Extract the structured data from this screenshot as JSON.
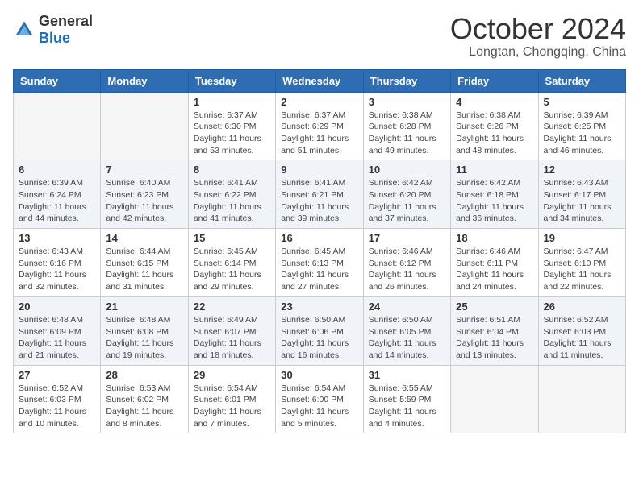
{
  "logo": {
    "general": "General",
    "blue": "Blue"
  },
  "header": {
    "month": "October 2024",
    "location": "Longtan, Chongqing, China"
  },
  "weekdays": [
    "Sunday",
    "Monday",
    "Tuesday",
    "Wednesday",
    "Thursday",
    "Friday",
    "Saturday"
  ],
  "weeks": [
    [
      {
        "day": "",
        "sunrise": "",
        "sunset": "",
        "daylight": ""
      },
      {
        "day": "",
        "sunrise": "",
        "sunset": "",
        "daylight": ""
      },
      {
        "day": "1",
        "sunrise": "Sunrise: 6:37 AM",
        "sunset": "Sunset: 6:30 PM",
        "daylight": "Daylight: 11 hours and 53 minutes."
      },
      {
        "day": "2",
        "sunrise": "Sunrise: 6:37 AM",
        "sunset": "Sunset: 6:29 PM",
        "daylight": "Daylight: 11 hours and 51 minutes."
      },
      {
        "day": "3",
        "sunrise": "Sunrise: 6:38 AM",
        "sunset": "Sunset: 6:28 PM",
        "daylight": "Daylight: 11 hours and 49 minutes."
      },
      {
        "day": "4",
        "sunrise": "Sunrise: 6:38 AM",
        "sunset": "Sunset: 6:26 PM",
        "daylight": "Daylight: 11 hours and 48 minutes."
      },
      {
        "day": "5",
        "sunrise": "Sunrise: 6:39 AM",
        "sunset": "Sunset: 6:25 PM",
        "daylight": "Daylight: 11 hours and 46 minutes."
      }
    ],
    [
      {
        "day": "6",
        "sunrise": "Sunrise: 6:39 AM",
        "sunset": "Sunset: 6:24 PM",
        "daylight": "Daylight: 11 hours and 44 minutes."
      },
      {
        "day": "7",
        "sunrise": "Sunrise: 6:40 AM",
        "sunset": "Sunset: 6:23 PM",
        "daylight": "Daylight: 11 hours and 42 minutes."
      },
      {
        "day": "8",
        "sunrise": "Sunrise: 6:41 AM",
        "sunset": "Sunset: 6:22 PM",
        "daylight": "Daylight: 11 hours and 41 minutes."
      },
      {
        "day": "9",
        "sunrise": "Sunrise: 6:41 AM",
        "sunset": "Sunset: 6:21 PM",
        "daylight": "Daylight: 11 hours and 39 minutes."
      },
      {
        "day": "10",
        "sunrise": "Sunrise: 6:42 AM",
        "sunset": "Sunset: 6:20 PM",
        "daylight": "Daylight: 11 hours and 37 minutes."
      },
      {
        "day": "11",
        "sunrise": "Sunrise: 6:42 AM",
        "sunset": "Sunset: 6:18 PM",
        "daylight": "Daylight: 11 hours and 36 minutes."
      },
      {
        "day": "12",
        "sunrise": "Sunrise: 6:43 AM",
        "sunset": "Sunset: 6:17 PM",
        "daylight": "Daylight: 11 hours and 34 minutes."
      }
    ],
    [
      {
        "day": "13",
        "sunrise": "Sunrise: 6:43 AM",
        "sunset": "Sunset: 6:16 PM",
        "daylight": "Daylight: 11 hours and 32 minutes."
      },
      {
        "day": "14",
        "sunrise": "Sunrise: 6:44 AM",
        "sunset": "Sunset: 6:15 PM",
        "daylight": "Daylight: 11 hours and 31 minutes."
      },
      {
        "day": "15",
        "sunrise": "Sunrise: 6:45 AM",
        "sunset": "Sunset: 6:14 PM",
        "daylight": "Daylight: 11 hours and 29 minutes."
      },
      {
        "day": "16",
        "sunrise": "Sunrise: 6:45 AM",
        "sunset": "Sunset: 6:13 PM",
        "daylight": "Daylight: 11 hours and 27 minutes."
      },
      {
        "day": "17",
        "sunrise": "Sunrise: 6:46 AM",
        "sunset": "Sunset: 6:12 PM",
        "daylight": "Daylight: 11 hours and 26 minutes."
      },
      {
        "day": "18",
        "sunrise": "Sunrise: 6:46 AM",
        "sunset": "Sunset: 6:11 PM",
        "daylight": "Daylight: 11 hours and 24 minutes."
      },
      {
        "day": "19",
        "sunrise": "Sunrise: 6:47 AM",
        "sunset": "Sunset: 6:10 PM",
        "daylight": "Daylight: 11 hours and 22 minutes."
      }
    ],
    [
      {
        "day": "20",
        "sunrise": "Sunrise: 6:48 AM",
        "sunset": "Sunset: 6:09 PM",
        "daylight": "Daylight: 11 hours and 21 minutes."
      },
      {
        "day": "21",
        "sunrise": "Sunrise: 6:48 AM",
        "sunset": "Sunset: 6:08 PM",
        "daylight": "Daylight: 11 hours and 19 minutes."
      },
      {
        "day": "22",
        "sunrise": "Sunrise: 6:49 AM",
        "sunset": "Sunset: 6:07 PM",
        "daylight": "Daylight: 11 hours and 18 minutes."
      },
      {
        "day": "23",
        "sunrise": "Sunrise: 6:50 AM",
        "sunset": "Sunset: 6:06 PM",
        "daylight": "Daylight: 11 hours and 16 minutes."
      },
      {
        "day": "24",
        "sunrise": "Sunrise: 6:50 AM",
        "sunset": "Sunset: 6:05 PM",
        "daylight": "Daylight: 11 hours and 14 minutes."
      },
      {
        "day": "25",
        "sunrise": "Sunrise: 6:51 AM",
        "sunset": "Sunset: 6:04 PM",
        "daylight": "Daylight: 11 hours and 13 minutes."
      },
      {
        "day": "26",
        "sunrise": "Sunrise: 6:52 AM",
        "sunset": "Sunset: 6:03 PM",
        "daylight": "Daylight: 11 hours and 11 minutes."
      }
    ],
    [
      {
        "day": "27",
        "sunrise": "Sunrise: 6:52 AM",
        "sunset": "Sunset: 6:03 PM",
        "daylight": "Daylight: 11 hours and 10 minutes."
      },
      {
        "day": "28",
        "sunrise": "Sunrise: 6:53 AM",
        "sunset": "Sunset: 6:02 PM",
        "daylight": "Daylight: 11 hours and 8 minutes."
      },
      {
        "day": "29",
        "sunrise": "Sunrise: 6:54 AM",
        "sunset": "Sunset: 6:01 PM",
        "daylight": "Daylight: 11 hours and 7 minutes."
      },
      {
        "day": "30",
        "sunrise": "Sunrise: 6:54 AM",
        "sunset": "Sunset: 6:00 PM",
        "daylight": "Daylight: 11 hours and 5 minutes."
      },
      {
        "day": "31",
        "sunrise": "Sunrise: 6:55 AM",
        "sunset": "Sunset: 5:59 PM",
        "daylight": "Daylight: 11 hours and 4 minutes."
      },
      {
        "day": "",
        "sunrise": "",
        "sunset": "",
        "daylight": ""
      },
      {
        "day": "",
        "sunrise": "",
        "sunset": "",
        "daylight": ""
      }
    ]
  ]
}
